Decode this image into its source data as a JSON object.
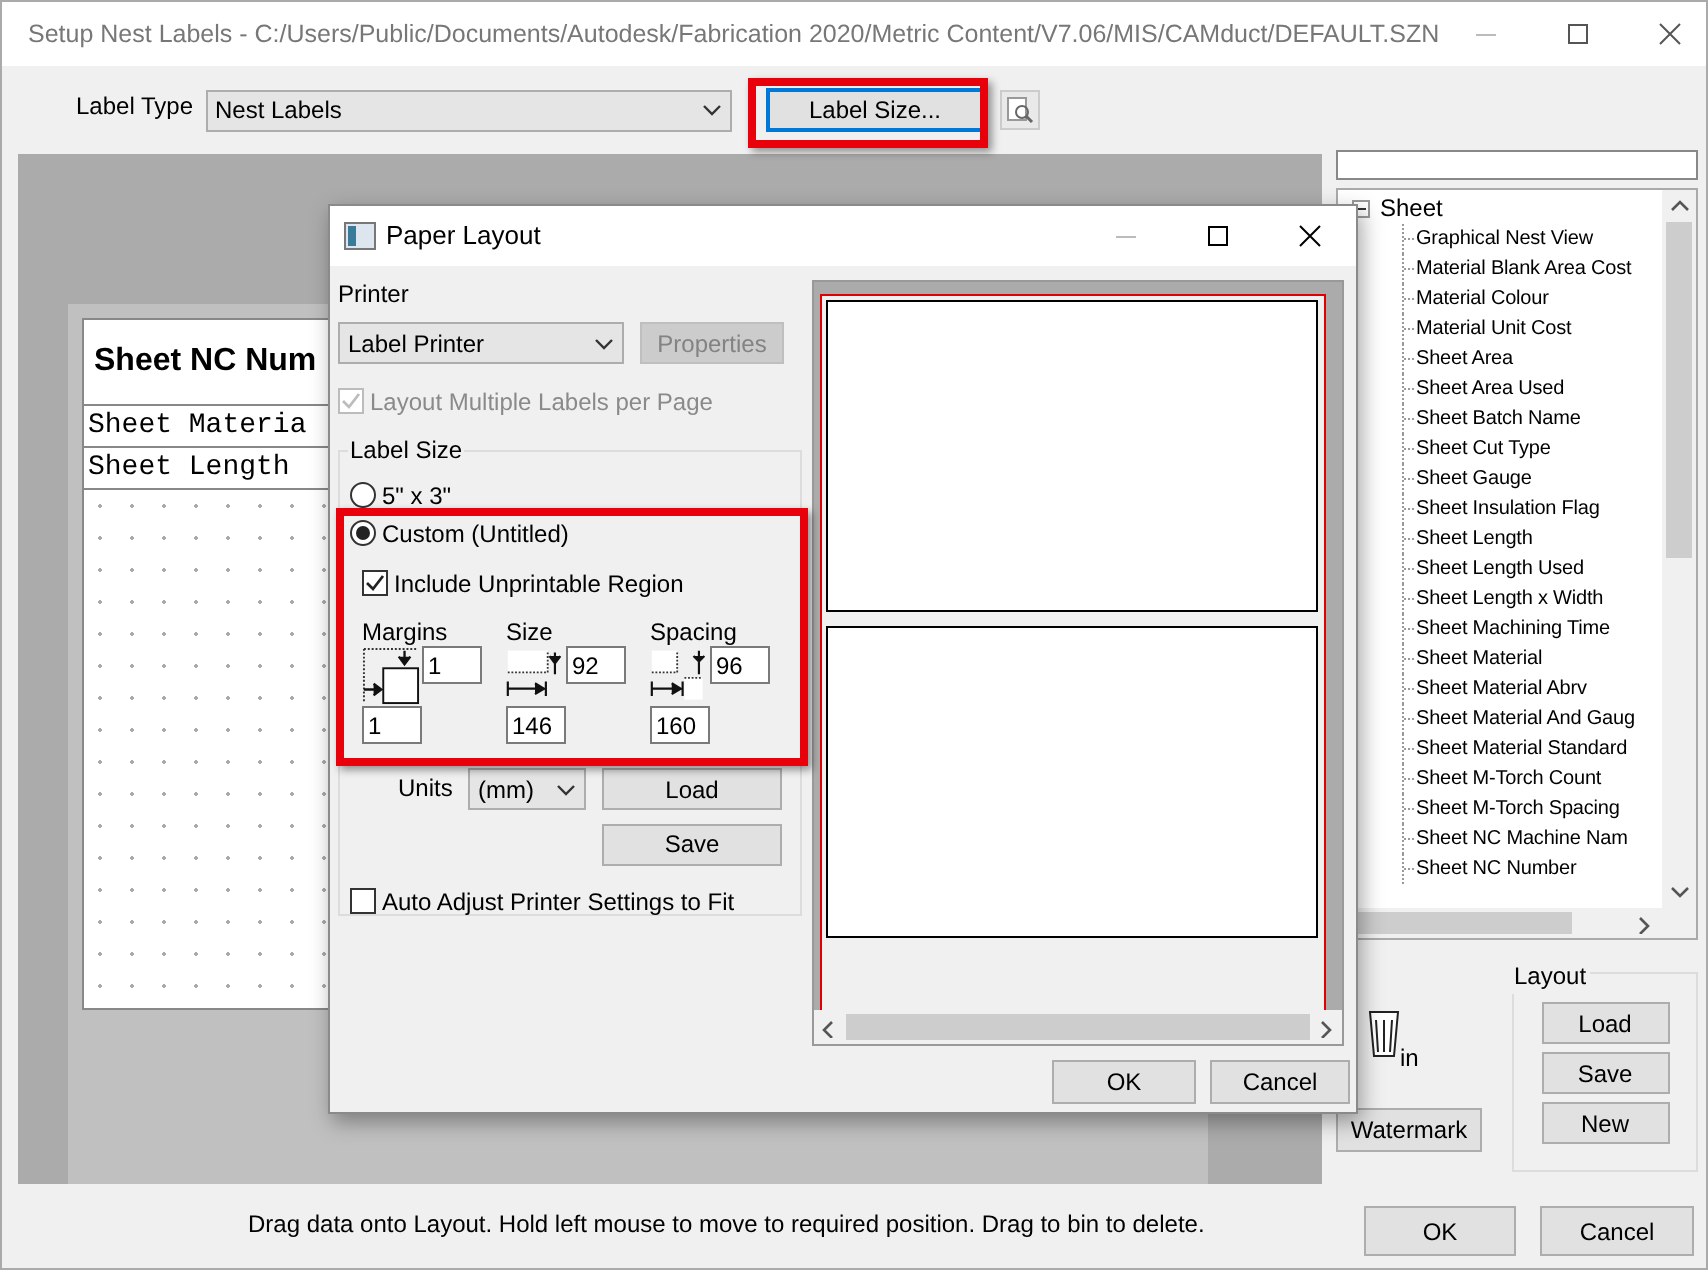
{
  "window": {
    "title": "Setup Nest Labels - C:/Users/Public/Documents/Autodesk/Fabrication 2020/Metric Content/V7.06/MIS/CAMduct/DEFAULT.SZN"
  },
  "label_type": {
    "label": "Label Type",
    "value": "Nest Labels"
  },
  "label_size_button": {
    "label": "Label Size...",
    "highlighted": true
  },
  "layout_preview": {
    "title": "Sheet NC Num",
    "rows": [
      "Sheet Materia",
      "Sheet Length"
    ]
  },
  "field_tree": {
    "root": {
      "label": "Sheet",
      "expanded": true,
      "children": [
        {
          "label": "Graphical Nest View"
        },
        {
          "label": "Material Blank Area Cost"
        },
        {
          "label": "Material Colour"
        },
        {
          "label": "Material Unit Cost"
        },
        {
          "label": "Sheet Area"
        },
        {
          "label": "Sheet Area Used"
        },
        {
          "label": "Sheet Batch Name"
        },
        {
          "label": "Sheet Cut Type"
        },
        {
          "label": "Sheet Gauge"
        },
        {
          "label": "Sheet Insulation Flag"
        },
        {
          "label": "Sheet Length"
        },
        {
          "label": "Sheet Length Used"
        },
        {
          "label": "Sheet Length x Width"
        },
        {
          "label": "Sheet Machining Time"
        },
        {
          "label": "Sheet Material"
        },
        {
          "label": "Sheet Material Abrv"
        },
        {
          "label": "Sheet Material And Gaug"
        },
        {
          "label": "Sheet Material Standard"
        },
        {
          "label": "Sheet M-Torch Count"
        },
        {
          "label": "Sheet M-Torch Spacing"
        },
        {
          "label": "Sheet NC Machine Nam"
        },
        {
          "label": "Sheet NC Number"
        }
      ]
    }
  },
  "bin": {
    "label": "in"
  },
  "watermark_button": "Watermark",
  "layout_group": {
    "title": "Layout",
    "buttons": [
      "Load",
      "Save",
      "New"
    ]
  },
  "status_text": "Drag data onto Layout. Hold left mouse to move to required position. Drag to bin to delete.",
  "buttons": [
    "OK",
    "Cancel"
  ],
  "dialog": {
    "title": "Paper Layout",
    "printer": {
      "label": "Printer",
      "value": "Label Printer",
      "properties_button": {
        "label": "Properties",
        "disabled": true
      }
    },
    "multiple_labels": {
      "label": "Layout Multiple Labels per Page",
      "checked": true,
      "disabled": true
    },
    "label_size": {
      "title": "Label Size",
      "highlighted": true,
      "options": [
        {
          "label": "5\" x 3\"",
          "selected": false
        },
        {
          "label": "Custom (Untitled)",
          "selected": true
        }
      ],
      "include_unprintable": {
        "label": "Include Unprintable Region",
        "checked": true
      },
      "groups": [
        {
          "kind": "margins",
          "label": "Margins",
          "vertical": "1",
          "horizontal": "1"
        },
        {
          "kind": "size",
          "label": "Size",
          "vertical": "92",
          "horizontal": "146"
        },
        {
          "kind": "spacing",
          "label": "Spacing",
          "vertical": "96",
          "horizontal": "160"
        }
      ]
    },
    "units": {
      "label": "Units",
      "value": "(mm)"
    },
    "load_button": "Load",
    "save_button": "Save",
    "auto_adjust": {
      "label": "Auto Adjust Printer Settings to Fit",
      "checked": false
    },
    "buttons": [
      "OK",
      "Cancel"
    ]
  }
}
